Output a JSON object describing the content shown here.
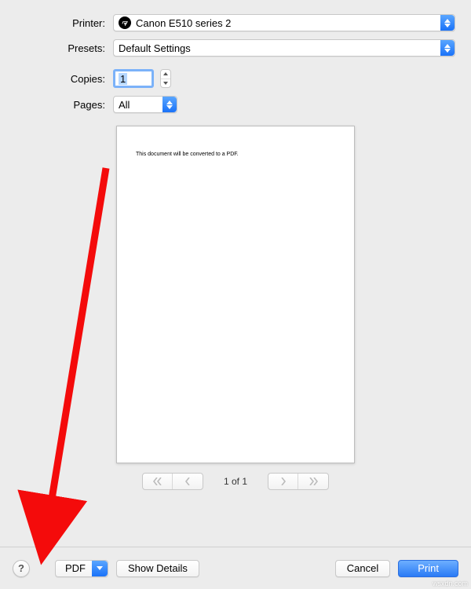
{
  "labels": {
    "printer": "Printer:",
    "presets": "Presets:",
    "copies": "Copies:",
    "pages": "Pages:"
  },
  "printer": {
    "value": "Canon E510 series 2"
  },
  "presets": {
    "value": "Default Settings"
  },
  "copies": {
    "value": "1"
  },
  "pages": {
    "value": "All"
  },
  "preview": {
    "text": "This document will be converted to a PDF."
  },
  "pager": {
    "label": "1 of 1"
  },
  "buttons": {
    "pdf": "PDF",
    "show_details": "Show Details",
    "cancel": "Cancel",
    "print": "Print",
    "help": "?"
  },
  "watermark": "wsxdn.com"
}
